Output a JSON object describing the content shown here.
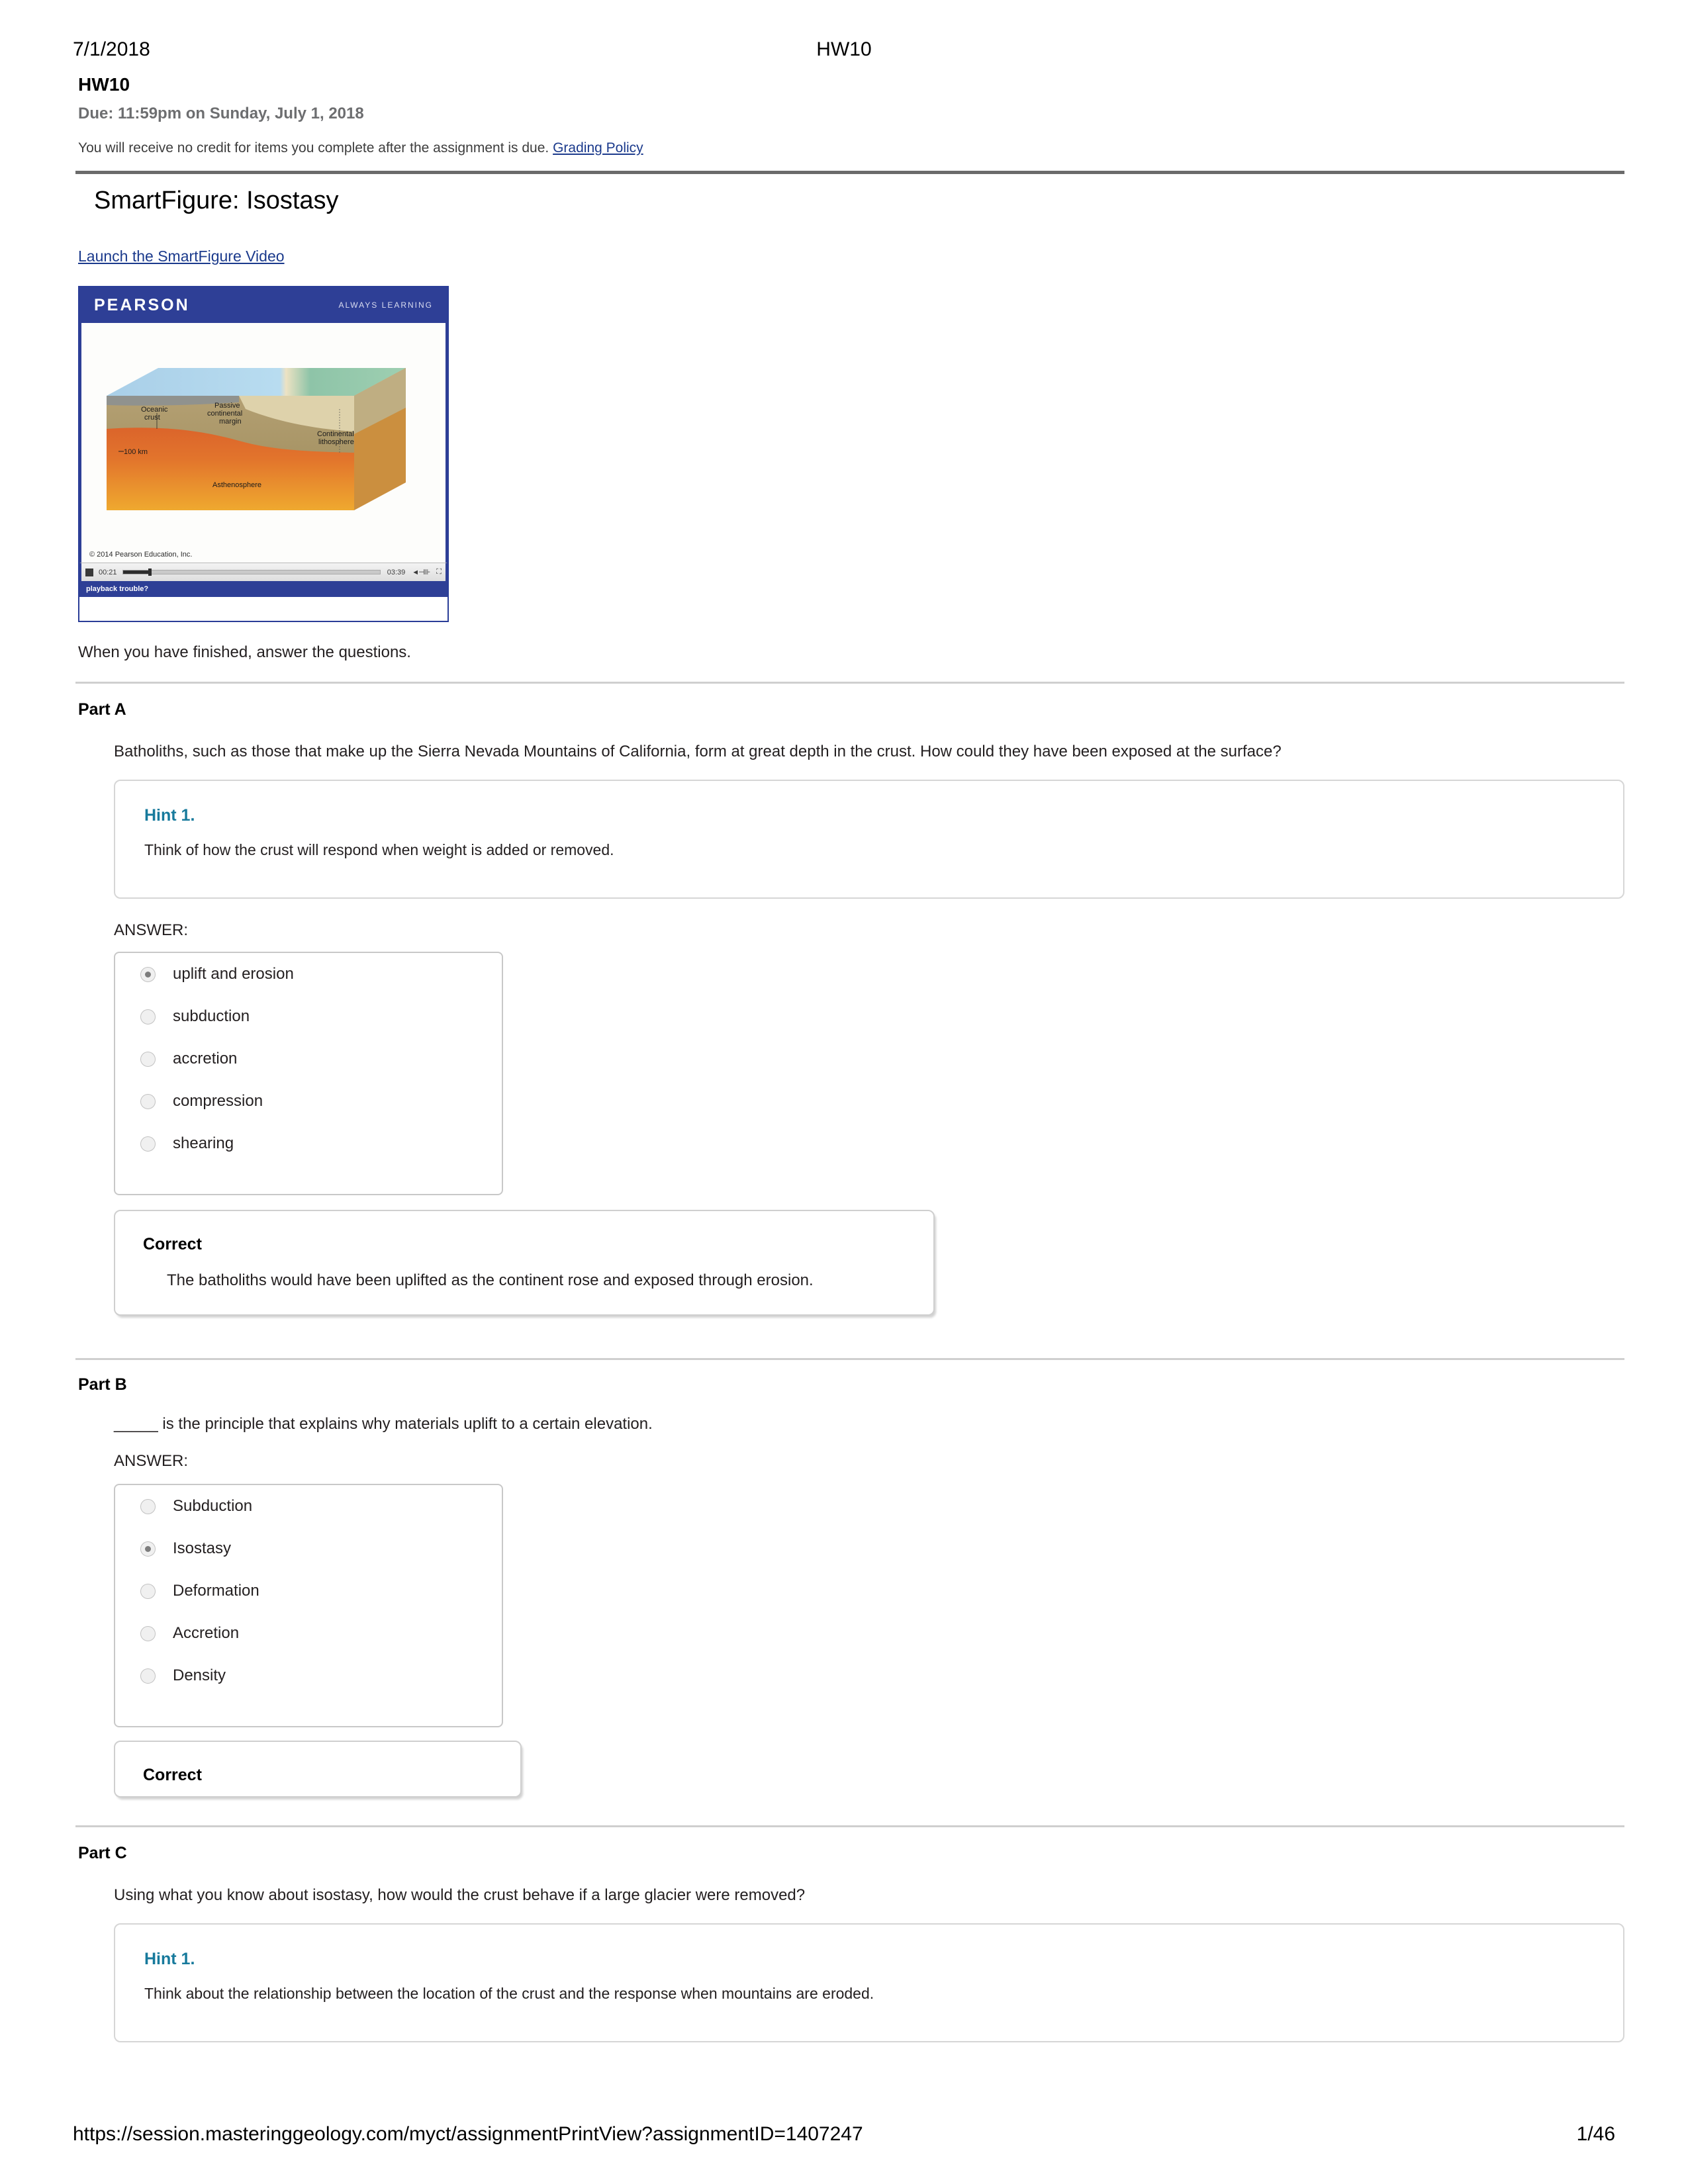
{
  "print_header": {
    "date": "7/1/2018",
    "title": "HW10",
    "right": ""
  },
  "assignment": {
    "name": "HW10",
    "due": "Due: 11:59pm on Sunday, July 1, 2018",
    "policy_text": "You will receive no credit for items you complete after the assignment is due.",
    "policy_link": "Grading Policy"
  },
  "item": {
    "title": "SmartFigure: Isostasy",
    "launch_link": "Launch the SmartFigure Video",
    "after_video_text": "When you have finished, answer the questions."
  },
  "video": {
    "brand": "PEARSON",
    "tagline": "ALWAYS LEARNING",
    "credit": "© 2014 Pearson Education, Inc.",
    "current_time": "00:21",
    "duration": "03:39",
    "playback_help": "playback trouble?",
    "diagram_labels": {
      "oceanic_crust": "Oceanic\ncrust",
      "oceanic_crust_l1": "Oceanic",
      "oceanic_crust_l2": "crust",
      "passive_margin_l1": "Passive",
      "passive_margin_l2": "continental",
      "passive_margin_l3": "margin",
      "continental_lith_l1": "Continental",
      "continental_lith_l2": "lithosphere",
      "depth": "100 km",
      "asthenosphere": "Asthenosphere"
    }
  },
  "parts": [
    {
      "label": "Part A",
      "question": "Batholiths, such as those that make up the Sierra Nevada Mountains of California, form at great depth in the crust. How could they have been exposed at the surface?",
      "hint_title": "Hint 1.",
      "hint_text": "Think of how the crust will respond when weight is added or removed.",
      "answer_label": "ANSWER:",
      "options": [
        {
          "label": "uplift and erosion",
          "selected": true
        },
        {
          "label": "subduction",
          "selected": false
        },
        {
          "label": "accretion",
          "selected": false
        },
        {
          "label": "compression",
          "selected": false
        },
        {
          "label": "shearing",
          "selected": false
        }
      ],
      "correct_title": "Correct",
      "correct_text": "The batholiths would have been uplifted as the continent rose and exposed through erosion."
    },
    {
      "label": "Part B",
      "question": "_____ is the principle that explains why materials uplift to a certain elevation.",
      "answer_label": "ANSWER:",
      "options": [
        {
          "label": "Subduction",
          "selected": false
        },
        {
          "label": "Isostasy",
          "selected": true
        },
        {
          "label": "Deformation",
          "selected": false
        },
        {
          "label": "Accretion",
          "selected": false
        },
        {
          "label": "Density",
          "selected": false
        }
      ],
      "correct_title": "Correct",
      "correct_text": ""
    },
    {
      "label": "Part C",
      "question": "Using what you know about isostasy, how would the crust behave if a large glacier were removed?",
      "hint_title": "Hint 1.",
      "hint_text": "Think about the relationship between the location of the crust and the response when mountains are eroded."
    }
  ],
  "print_footer": {
    "url": "https://session.masteringgeology.com/myct/assignmentPrintView?assignmentID=1407247",
    "page": "1/46"
  },
  "colors": {
    "link": "#1b3a8c",
    "hint": "#177a9c",
    "rule_thick": "#6b6b6b",
    "rule_thin": "#cfcfcf",
    "pearson_blue": "#2e3f96",
    "due_gray": "#6d6e70"
  }
}
